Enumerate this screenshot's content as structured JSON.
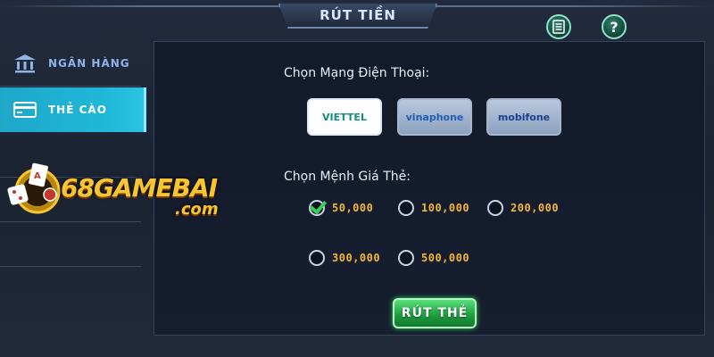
{
  "header": {
    "title": "RÚT TIỀN"
  },
  "sidebar": {
    "items": [
      {
        "label": "NGÂN HÀNG",
        "icon": "bank-icon",
        "active": false
      },
      {
        "label": "THẺ CÀO",
        "icon": "card-icon",
        "active": true
      }
    ]
  },
  "logo": {
    "main": "68GAMEBAI",
    "sub": ".com"
  },
  "main": {
    "carrier_label": "Chọn Mạng Điện Thoại:",
    "carriers": [
      {
        "name": "VIETTEL",
        "selected": true
      },
      {
        "name": "vinaphone",
        "selected": false
      },
      {
        "name": "mobifone",
        "selected": false
      }
    ],
    "denomination_label": "Chọn Mệnh Giá Thẻ:",
    "denominations": [
      {
        "value": "50,000",
        "checked": true
      },
      {
        "value": "100,000",
        "checked": false
      },
      {
        "value": "200,000",
        "checked": false
      },
      {
        "value": "300,000",
        "checked": false
      },
      {
        "value": "500,000",
        "checked": false
      }
    ],
    "submit_label": "RÚT THẺ"
  },
  "colors": {
    "accent": "#1fb7d8",
    "gold": "#f2b83a",
    "submit": "#1d9a3d"
  }
}
